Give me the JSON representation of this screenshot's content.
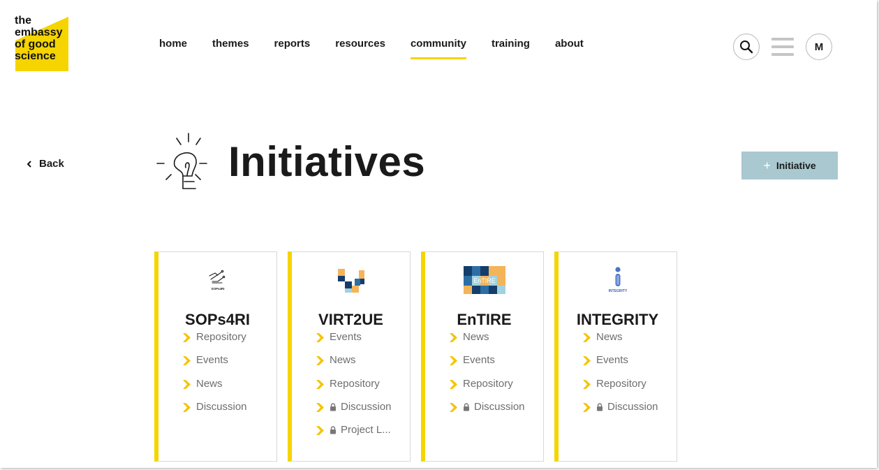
{
  "logo": {
    "lines": [
      "the",
      "embassy",
      "of good",
      "science"
    ]
  },
  "nav": {
    "items": [
      {
        "label": "home",
        "active": false
      },
      {
        "label": "themes",
        "active": false
      },
      {
        "label": "reports",
        "active": false
      },
      {
        "label": "resources",
        "active": false
      },
      {
        "label": "community",
        "active": true
      },
      {
        "label": "training",
        "active": false
      },
      {
        "label": "about",
        "active": false
      }
    ],
    "search_icon": "search-icon",
    "menu_icon": "hamburger-icon",
    "user_initial": "M"
  },
  "header": {
    "back_label": "Back",
    "title": "Initiatives",
    "title_icon": "lightbulb-icon",
    "add_button_label": "Initiative"
  },
  "colors": {
    "accent_yellow": "#f5d400",
    "add_button_bg": "#a9c8d0",
    "link_gray": "#6e6e6e"
  },
  "cards": [
    {
      "title": "SOPs4RI",
      "logo_text": "SOPs4RI",
      "links": [
        {
          "label": "Repository",
          "locked": false
        },
        {
          "label": "Events",
          "locked": false
        },
        {
          "label": "News",
          "locked": false
        },
        {
          "label": "Discussion",
          "locked": false
        }
      ]
    },
    {
      "title": "VIRT2UE",
      "links": [
        {
          "label": "Events",
          "locked": false
        },
        {
          "label": "News",
          "locked": false
        },
        {
          "label": "Repository",
          "locked": false
        },
        {
          "label": "Discussion",
          "locked": true
        },
        {
          "label": "Project L...",
          "locked": true
        }
      ]
    },
    {
      "title": "EnTIRE",
      "logo_text": "EnTIRE",
      "links": [
        {
          "label": "News",
          "locked": false
        },
        {
          "label": "Events",
          "locked": false
        },
        {
          "label": "Repository",
          "locked": false
        },
        {
          "label": "Discussion",
          "locked": true
        }
      ]
    },
    {
      "title": "INTEGRITY",
      "logo_text": "INTEGRITY",
      "links": [
        {
          "label": "News",
          "locked": false
        },
        {
          "label": "Events",
          "locked": false
        },
        {
          "label": "Repository",
          "locked": false
        },
        {
          "label": "Discussion",
          "locked": true
        }
      ]
    }
  ]
}
